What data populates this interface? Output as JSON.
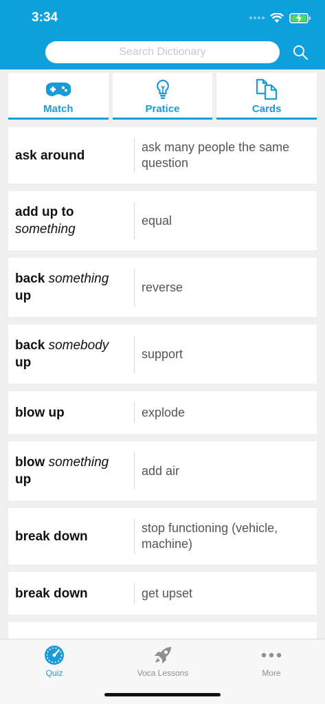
{
  "status": {
    "time": "3:34"
  },
  "search": {
    "placeholder": "Search Dictionary"
  },
  "modes": [
    {
      "label": "Match",
      "icon": "gamepad-icon"
    },
    {
      "label": "Pratice",
      "icon": "lightbulb-icon"
    },
    {
      "label": "Cards",
      "icon": "cards-icon"
    }
  ],
  "entries": [
    {
      "term": [
        {
          "t": "ask around",
          "s": "b"
        }
      ],
      "meaning": "ask many people the same question"
    },
    {
      "term": [
        {
          "t": "add up to ",
          "s": "b"
        },
        {
          "t": "something",
          "s": "i"
        }
      ],
      "meaning": "equal"
    },
    {
      "term": [
        {
          "t": "back ",
          "s": "b"
        },
        {
          "t": "something",
          "s": "i"
        },
        {
          "t": " up",
          "s": "b"
        }
      ],
      "meaning": "reverse"
    },
    {
      "term": [
        {
          "t": "back ",
          "s": "b"
        },
        {
          "t": "somebody",
          "s": "i"
        },
        {
          "t": " up",
          "s": "b"
        }
      ],
      "meaning": "support"
    },
    {
      "term": [
        {
          "t": "blow up",
          "s": "b"
        }
      ],
      "meaning": "explode"
    },
    {
      "term": [
        {
          "t": "blow ",
          "s": "b"
        },
        {
          "t": "something",
          "s": "i"
        },
        {
          "t": " up",
          "s": "b"
        }
      ],
      "meaning": "add air"
    },
    {
      "term": [
        {
          "t": "break down",
          "s": "b"
        }
      ],
      "meaning": "stop functioning (vehicle, machine)"
    },
    {
      "term": [
        {
          "t": "break down",
          "s": "b"
        }
      ],
      "meaning": "get upset"
    },
    {
      "term": [],
      "meaning": ""
    }
  ],
  "tabs": [
    {
      "label": "Quiz",
      "icon": "speedometer-icon",
      "active": true
    },
    {
      "label": "Voca Lessons",
      "icon": "rocket-icon",
      "active": false
    },
    {
      "label": "More",
      "icon": "more-dots-icon",
      "active": false
    }
  ],
  "colors": {
    "header": "#0da0dc",
    "accent": "#1a9bd7",
    "background": "#efefef",
    "battery": "#4cd964"
  }
}
